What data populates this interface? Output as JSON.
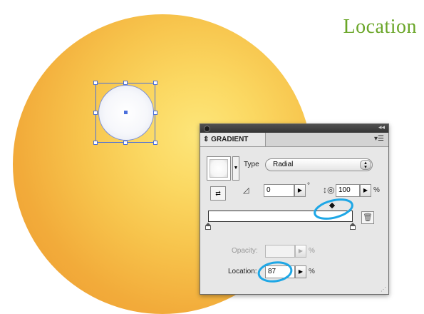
{
  "heading": "Location",
  "panel": {
    "title": "GRADIENT",
    "type_label": "Type",
    "type_value": "Radial",
    "angle_value": "0",
    "angle_unit": "°",
    "aspect_value": "100",
    "aspect_unit": "%",
    "opacity_label": "Opacity:",
    "opacity_value": "",
    "opacity_unit": "%",
    "location_label": "Location:",
    "location_value": "87",
    "location_unit": "%"
  },
  "colors": {
    "heading": "#6aa628",
    "annotation": "#1ea7e6",
    "selection": "#4a6fdc",
    "sphere_light": "#fde67a",
    "sphere_dark": "#ec9a30"
  }
}
